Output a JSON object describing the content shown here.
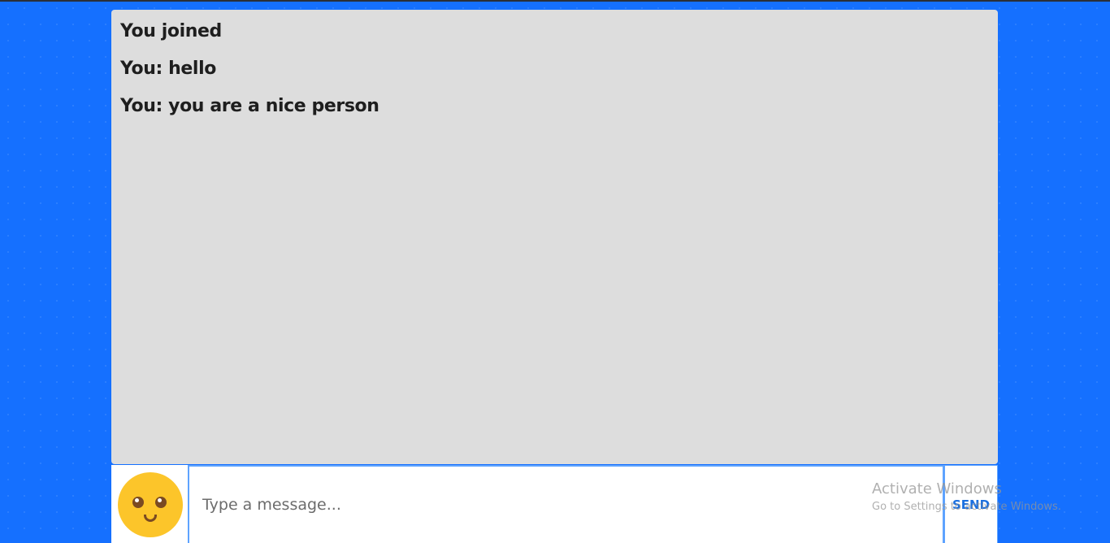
{
  "chat": {
    "messages": [
      "You joined",
      "You: hello",
      "You: you are a nice person"
    ]
  },
  "composer": {
    "emoji_icon": "smiley-face-icon",
    "input_placeholder": "Type a message...",
    "input_value": "",
    "send_label": "SEND"
  },
  "watermark": {
    "title": "Activate Windows",
    "subtitle": "Go to Settings to activate Windows."
  },
  "colors": {
    "background": "#1570ff",
    "chat_panel": "#dddddd",
    "accent": "#1a6fe0",
    "emoji": "#fcc52a"
  }
}
